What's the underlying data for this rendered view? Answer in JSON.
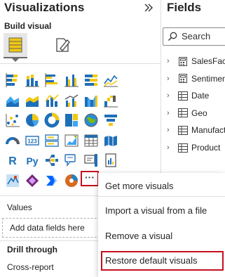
{
  "visualizations": {
    "title": "Visualizations",
    "build_label": "Build visual",
    "values_label": "Values",
    "add_field_placeholder": "Add data fields here",
    "drill_label": "Drill through",
    "cross_report_label": "Cross-report",
    "more_button": "···"
  },
  "fields": {
    "title": "Fields",
    "search_placeholder": "Search",
    "tables": [
      {
        "name": "SalesFact",
        "icon": "table-calc-icon"
      },
      {
        "name": "Sentiment",
        "icon": "table-calc-icon"
      },
      {
        "name": "Date",
        "icon": "table-icon"
      },
      {
        "name": "Geo",
        "icon": "table-icon"
      },
      {
        "name": "Manufact",
        "icon": "table-icon"
      },
      {
        "name": "Product",
        "icon": "table-icon"
      }
    ]
  },
  "context_menu": {
    "items": [
      "Get more visuals",
      "Import a visual from a file",
      "Remove a visual",
      "Restore default visuals"
    ],
    "highlight_color": "#c50f1f"
  },
  "viz_icons": [
    "stacked-bar-icon",
    "stacked-column-icon",
    "clustered-bar-icon",
    "clustered-column-icon",
    "100-stacked-bar-icon",
    "line-chart-icon",
    "area-chart-icon",
    "stacked-area-icon",
    "line-column-icon",
    "line-clustered-icon",
    "ribbon-chart-icon",
    "waterfall-icon",
    "scatter-icon",
    "pie-icon",
    "donut-icon",
    "treemap-icon",
    "map-icon",
    "funnel-icon",
    "gauge-icon",
    "card-icon",
    "multi-row-card-icon",
    "kpi-icon",
    "table-viz-icon",
    "filled-map-icon",
    "r-visual-icon",
    "python-visual-icon",
    "decomposition-tree-icon",
    "smart-narrative-icon",
    "qna-icon",
    "paginated-report-icon",
    "azure-map-icon",
    "power-apps-icon",
    "power-automate-icon",
    "arcgis-icon"
  ]
}
